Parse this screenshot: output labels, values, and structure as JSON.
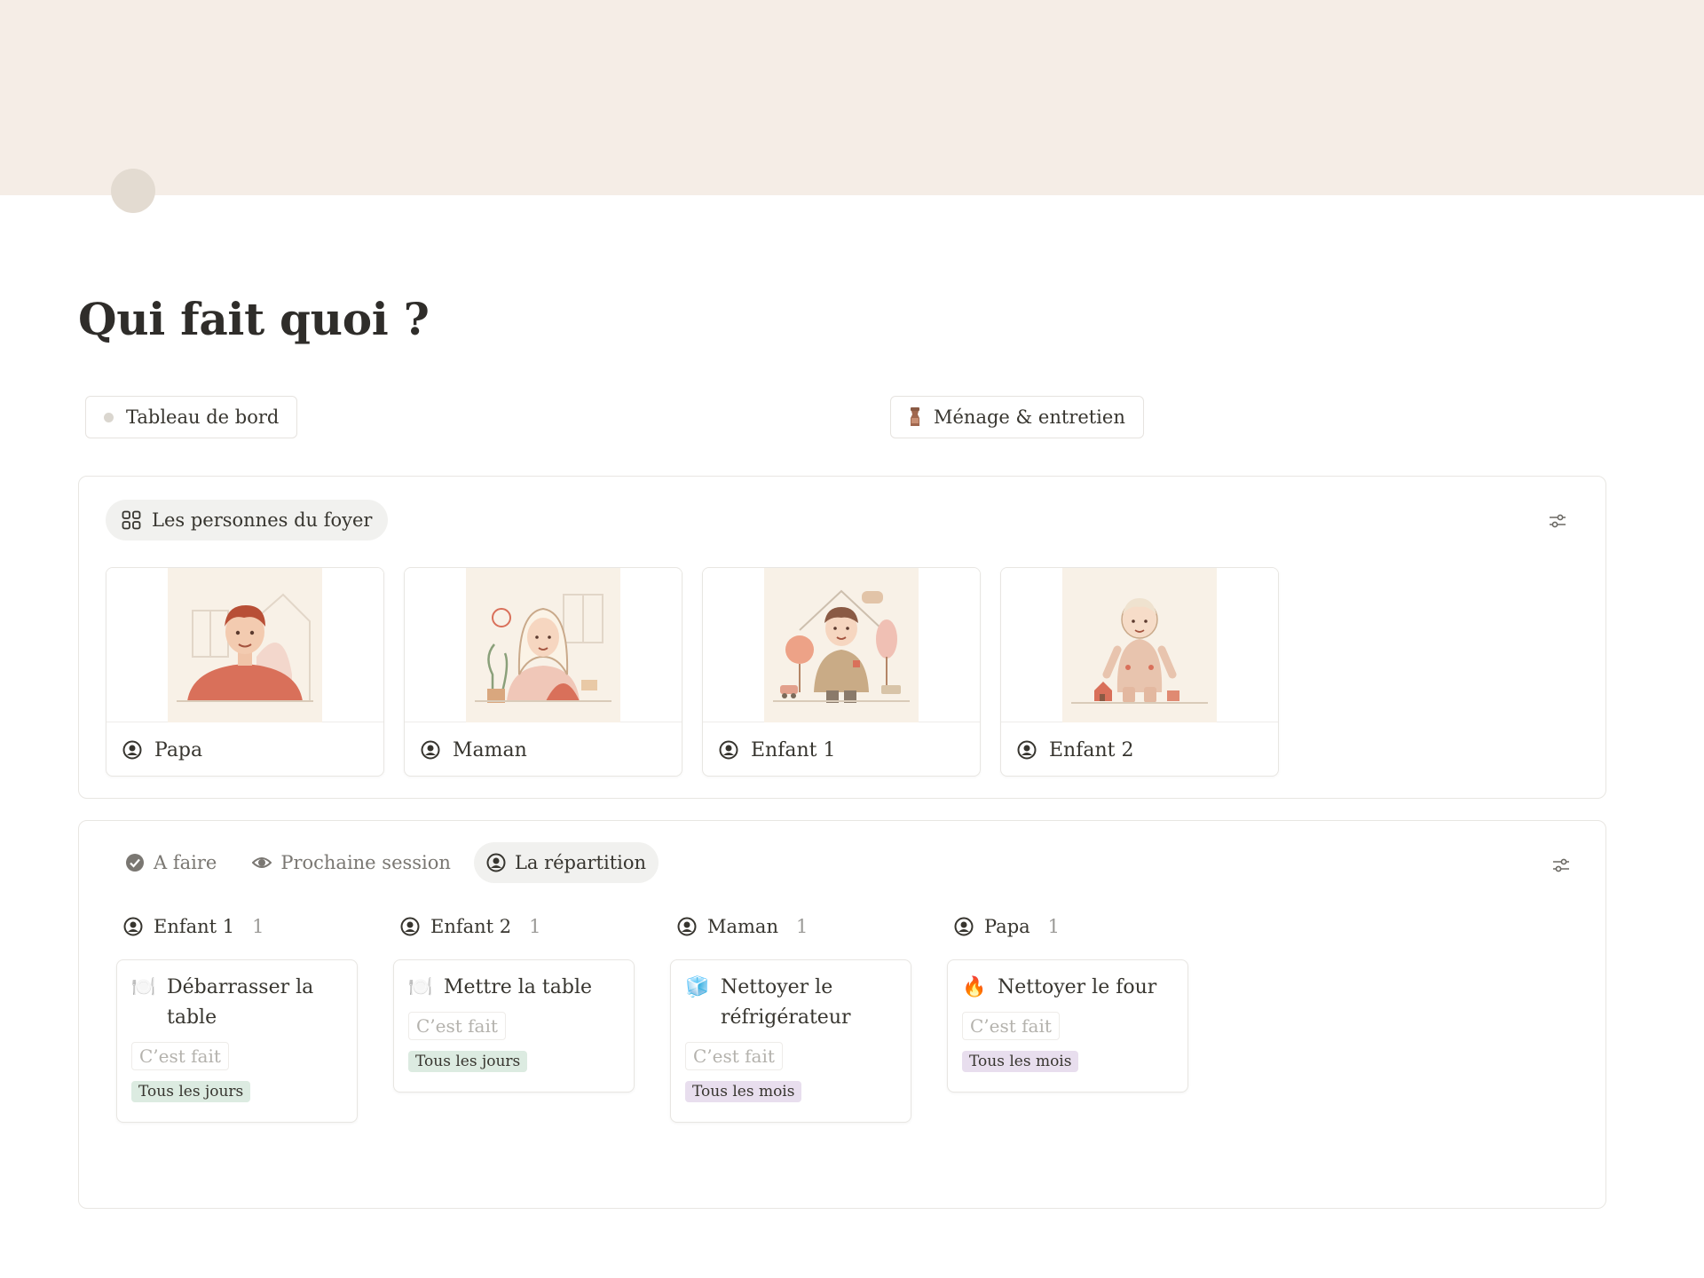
{
  "page": {
    "title": "Qui fait quoi ?"
  },
  "links": [
    {
      "label": "Tableau de bord",
      "icon": "dot-icon"
    },
    {
      "label": "Ménage & entretien",
      "icon": "spray-bottle-icon"
    }
  ],
  "household": {
    "view_label": "Les personnes du foyer",
    "members": [
      {
        "name": "Papa",
        "art": "father-illustration"
      },
      {
        "name": "Maman",
        "art": "mother-illustration"
      },
      {
        "name": "Enfant 1",
        "art": "boy-illustration"
      },
      {
        "name": "Enfant 2",
        "art": "toddler-illustration"
      }
    ]
  },
  "tasks_db": {
    "tabs": [
      {
        "label": "A faire",
        "icon": "check-circle-icon",
        "active": false
      },
      {
        "label": "Prochaine session",
        "icon": "eye-icon",
        "active": false
      },
      {
        "label": "La répartition",
        "icon": "person-icon",
        "active": true
      }
    ],
    "columns": [
      {
        "name": "Enfant 1",
        "count": "1",
        "cards": [
          {
            "emoji": "🍽️",
            "title": "Débarrasser la table",
            "button": "C’est fait",
            "tag": "Tous les jours",
            "tag_color": "green"
          }
        ]
      },
      {
        "name": "Enfant 2",
        "count": "1",
        "cards": [
          {
            "emoji": "🍽️",
            "title": "Mettre la table",
            "button": "C’est fait",
            "tag": "Tous les jours",
            "tag_color": "green"
          }
        ]
      },
      {
        "name": "Maman",
        "count": "1",
        "cards": [
          {
            "emoji": "🧊",
            "title": "Nettoyer le réfrigérateur",
            "button": "C’est fait",
            "tag": "Tous les mois",
            "tag_color": "purple"
          }
        ]
      },
      {
        "name": "Papa",
        "count": "1",
        "cards": [
          {
            "emoji": "🔥",
            "title": "Nettoyer le four",
            "button": "C’est fait",
            "tag": "Tous les mois",
            "tag_color": "purple"
          }
        ]
      }
    ]
  },
  "colors": {
    "cover": "#f5ede6",
    "page_icon": "#e3dbd1",
    "tag_green": "#dcebe1",
    "tag_purple": "#e8deee",
    "art_background": "#f8f1e7"
  }
}
